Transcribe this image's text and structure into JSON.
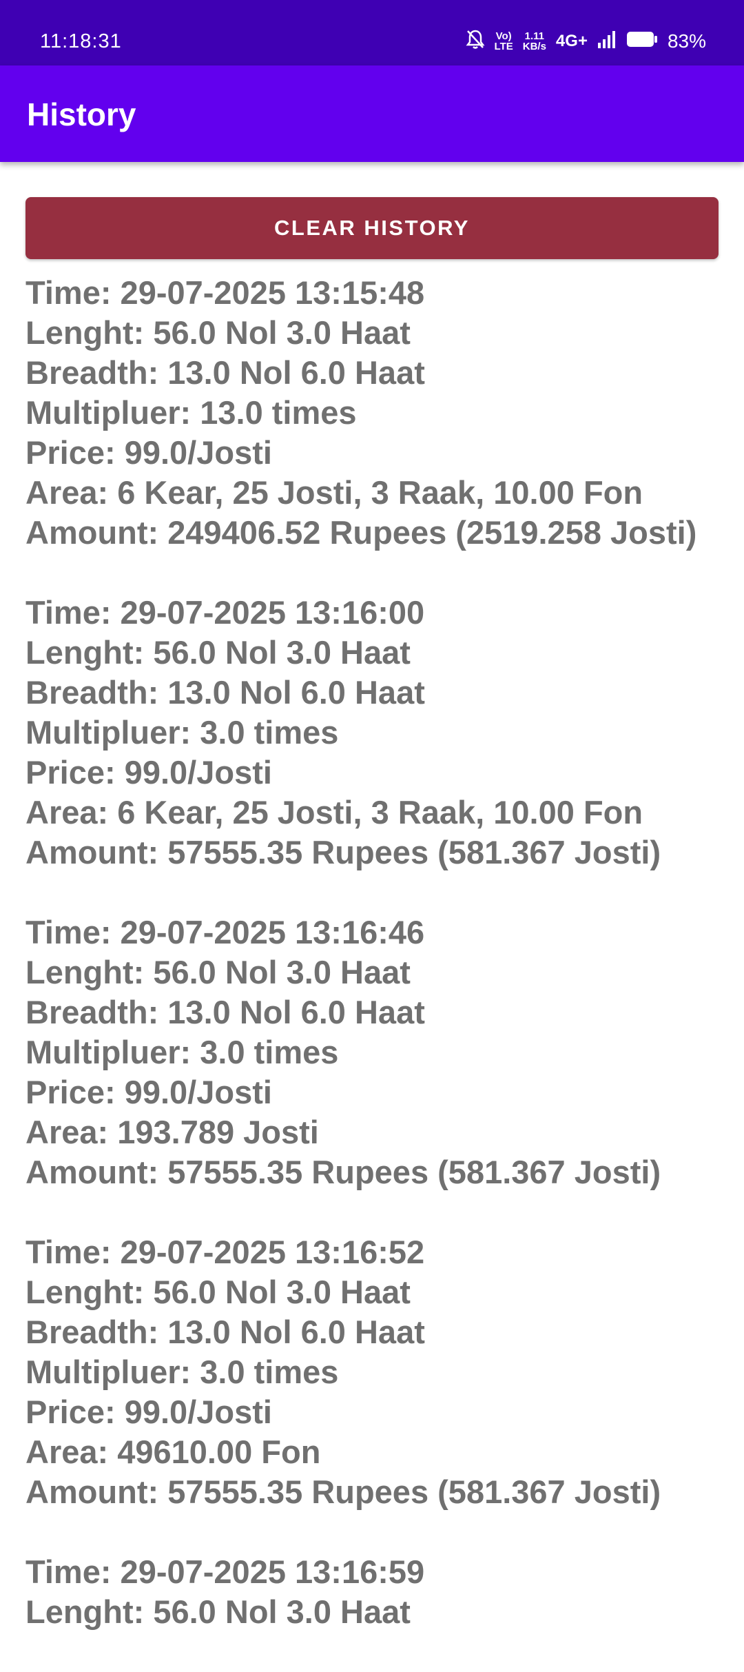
{
  "status_bar": {
    "time": "11:18:31",
    "volte_top": "Vo)",
    "volte_bottom": "LTE",
    "speed_top": "1.11",
    "speed_bottom": "KB/s",
    "network": "4G+",
    "battery": "83%"
  },
  "app_bar": {
    "title": "History"
  },
  "clear_button": {
    "label": "CLEAR HISTORY"
  },
  "entries": [
    {
      "time": "Time: 29-07-2025 13:15:48",
      "length": "Lenght: 56.0 Nol 3.0 Haat",
      "breadth": "Breadth: 13.0 Nol 6.0 Haat",
      "multiplier": "Multipluer: 13.0 times",
      "price": "Price: 99.0/Josti",
      "area": "Area: 6 Kear, 25 Josti, 3 Raak, 10.00 Fon",
      "amount": "Amount: 249406.52 Rupees (2519.258 Josti)"
    },
    {
      "time": "Time: 29-07-2025 13:16:00",
      "length": "Lenght: 56.0 Nol 3.0 Haat",
      "breadth": "Breadth: 13.0 Nol 6.0 Haat",
      "multiplier": "Multipluer: 3.0 times",
      "price": "Price: 99.0/Josti",
      "area": "Area: 6 Kear, 25 Josti, 3 Raak, 10.00 Fon",
      "amount": "Amount: 57555.35 Rupees (581.367 Josti)"
    },
    {
      "time": "Time: 29-07-2025 13:16:46",
      "length": "Lenght: 56.0 Nol 3.0 Haat",
      "breadth": "Breadth: 13.0 Nol 6.0 Haat",
      "multiplier": "Multipluer: 3.0 times",
      "price": "Price: 99.0/Josti",
      "area": "Area: 193.789 Josti",
      "amount": "Amount: 57555.35 Rupees (581.367 Josti)"
    },
    {
      "time": "Time: 29-07-2025 13:16:52",
      "length": "Lenght: 56.0 Nol 3.0 Haat",
      "breadth": "Breadth: 13.0 Nol 6.0 Haat",
      "multiplier": "Multipluer: 3.0 times",
      "price": "Price: 99.0/Josti",
      "area": "Area: 49610.00 Fon",
      "amount": "Amount: 57555.35 Rupees (581.367 Josti)"
    },
    {
      "time": "Time: 29-07-2025 13:16:59",
      "length": "Lenght: 56.0 Nol 3.0 Haat",
      "breadth": "",
      "multiplier": "",
      "price": "",
      "area": "",
      "amount": ""
    }
  ],
  "colors": {
    "status_bar": "#3f00b3",
    "app_bar": "#6200ee",
    "clear_button": "#962f40",
    "entry_text": "#707070"
  },
  "icons": [
    "mute-bell-icon",
    "signal-bars-icon",
    "battery-icon"
  ]
}
